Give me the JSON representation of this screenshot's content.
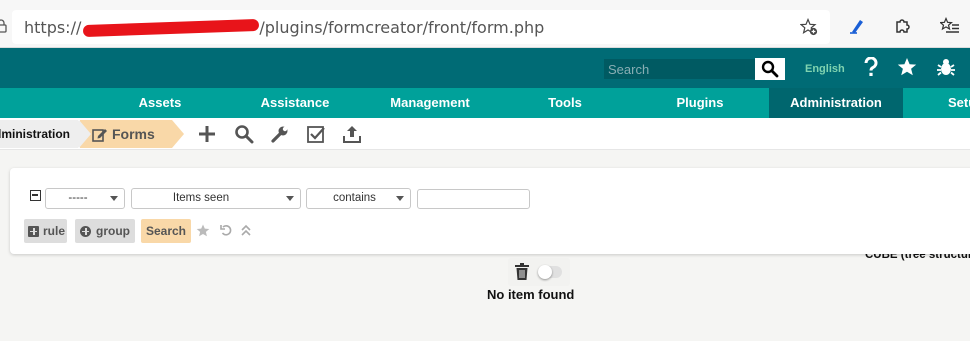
{
  "browser": {
    "url_scheme": "https://",
    "url_path": "/plugins/formcreator/front/form.php"
  },
  "header": {
    "search_placeholder": "Search",
    "language": "English"
  },
  "menu": {
    "items": [
      "Assets",
      "Assistance",
      "Management",
      "Tools",
      "Plugins",
      "Administration",
      "Setup"
    ],
    "active": "Administration"
  },
  "breadcrumb": {
    "parent": "Administration",
    "current": "Forms"
  },
  "entity": "CUBE (tree structure)",
  "criteria": {
    "link_value": "-----",
    "field_value": "Items seen",
    "operator_value": "contains",
    "value": ""
  },
  "buttons": {
    "rule": "rule",
    "group": "group",
    "search": "Search"
  },
  "results": {
    "empty_message": "No item found"
  },
  "colors": {
    "header": "#006b75",
    "menu": "#00a19a",
    "menu_active": "#00666e",
    "accent": "#f9d8a8"
  }
}
